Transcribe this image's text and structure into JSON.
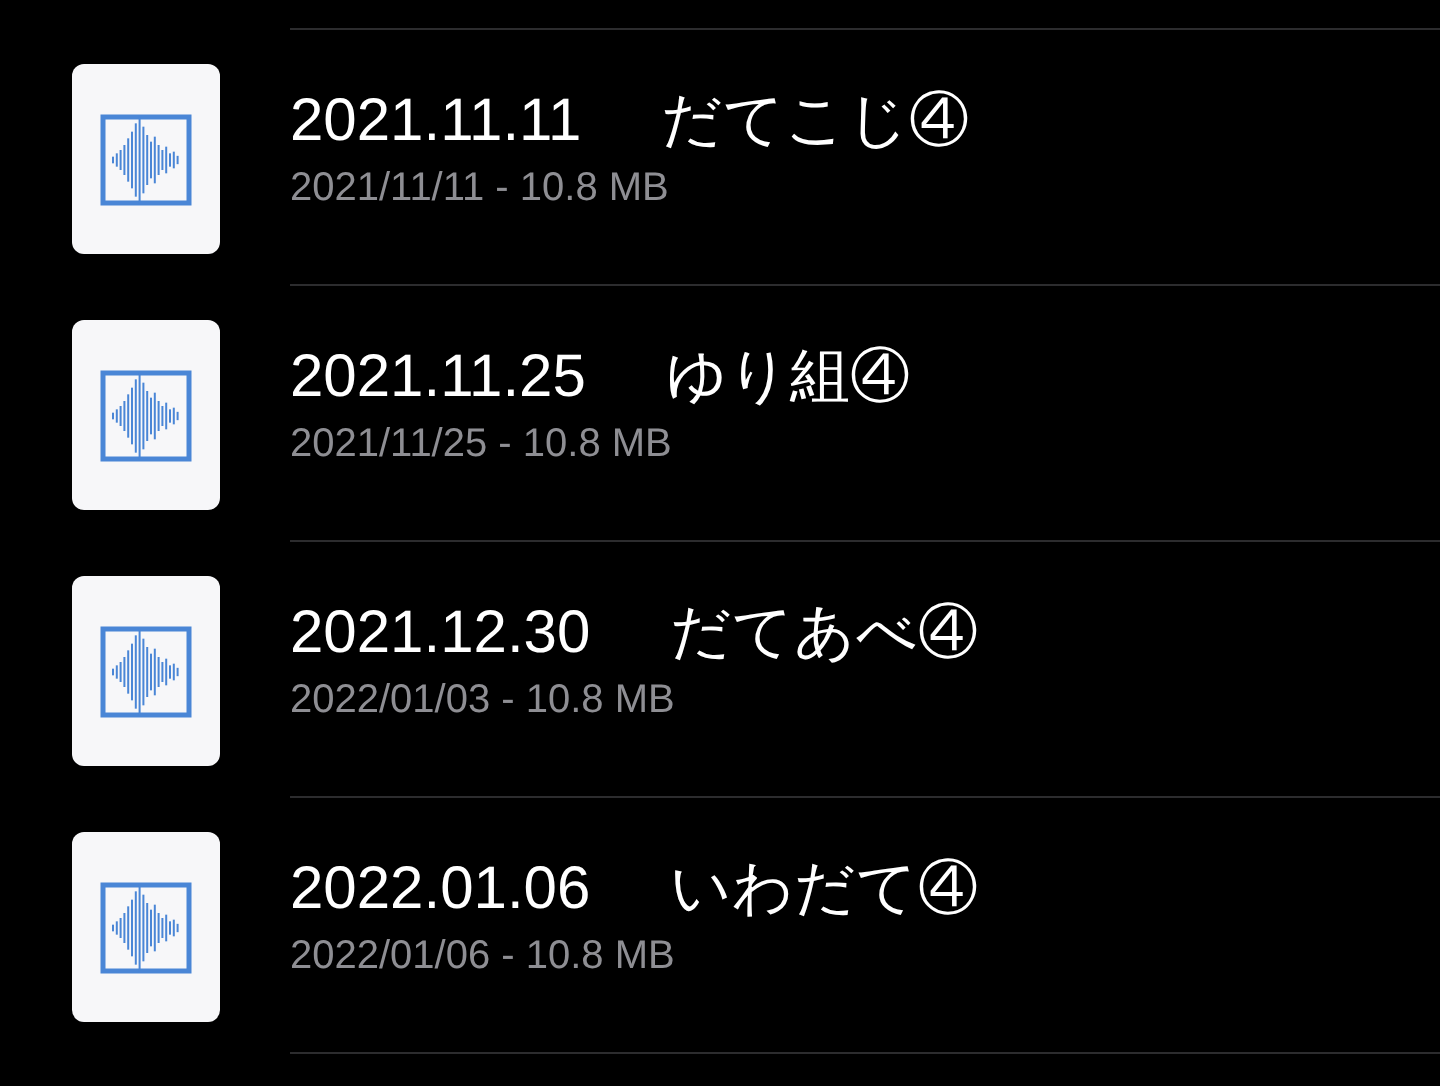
{
  "files": [
    {
      "title": "2021.11.11",
      "name": "だてこじ④",
      "details": "2021/11/11 - 10.8 MB"
    },
    {
      "title": "2021.11.25",
      "name": "ゆり組④",
      "details": "2021/11/25 - 10.8 MB"
    },
    {
      "title": "2021.12.30",
      "name": "だてあべ④",
      "details": "2022/01/03 - 10.8 MB"
    },
    {
      "title": "2022.01.06",
      "name": "いわだて④",
      "details": "2022/01/06 - 10.8 MB"
    }
  ]
}
